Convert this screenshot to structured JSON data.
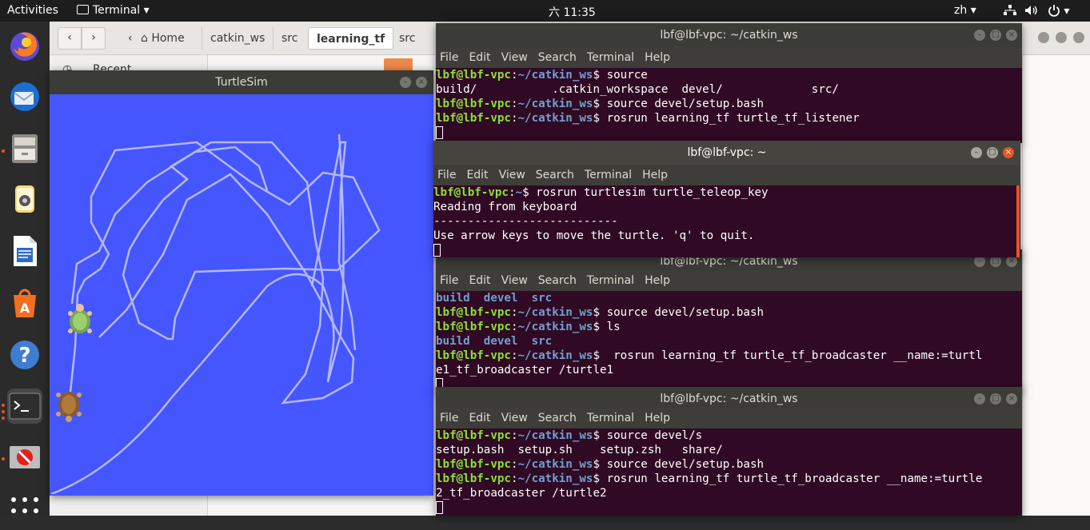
{
  "topbar": {
    "activities": "Activities",
    "app_menu": "Terminal",
    "app_menu_arrow": "▾",
    "clock": "六 11:35",
    "lang": "zh",
    "lang_arrow": "▾",
    "power_arrow": "▾"
  },
  "dock": {
    "items": [
      "Firefox",
      "Thunderbird",
      "Files",
      "Rhythmbox",
      "LibreOffice Writer",
      "Ubuntu Software",
      "Help",
      "Terminal",
      "Disabled App",
      "Show Applications"
    ]
  },
  "files": {
    "nav_back": "‹",
    "nav_forward": "›",
    "crumbs": [
      "Home",
      "catkin_ws",
      "src",
      "learning_tf",
      "src"
    ],
    "active_crumb_index": 3,
    "sidebar_recent": "Recent"
  },
  "turtlesim": {
    "title": "TurtleSim",
    "bg_color": "#4556ff",
    "line_color": "#b3b8ff"
  },
  "term_a": {
    "title": "lbf@lbf-vpc: ~/catkin_ws",
    "menu": [
      "File",
      "Edit",
      "View",
      "Search",
      "Terminal",
      "Help"
    ],
    "lines": [
      {
        "user": "lbf@lbf-vpc",
        "path": "~/catkin_ws",
        "cmd": " source"
      },
      {
        "text": "build/           .catkin_workspace  devel/             src/"
      },
      {
        "user": "lbf@lbf-vpc",
        "path": "~/catkin_ws",
        "cmd": " source devel/setup.bash"
      },
      {
        "user": "lbf@lbf-vpc",
        "path": "~/catkin_ws",
        "cmd": " rosrun learning_tf turtle_tf_listener"
      }
    ]
  },
  "term_b": {
    "title": "lbf@lbf-vpc: ~",
    "menu": [
      "File",
      "Edit",
      "View",
      "Search",
      "Terminal",
      "Help"
    ],
    "lines": [
      {
        "user": "lbf@lbf-vpc",
        "path": "~",
        "cmd": " rosrun turtlesim turtle_teleop_key"
      },
      {
        "text": "Reading from keyboard"
      },
      {
        "text": "---------------------------"
      },
      {
        "text": "Use arrow keys to move the turtle. 'q' to quit."
      }
    ]
  },
  "term_c": {
    "title": "lbf@lbf-vpc: ~/catkin_ws",
    "menu": [
      "File",
      "Edit",
      "View",
      "Search",
      "Terminal",
      "Help"
    ],
    "lines": [
      {
        "dirs": "build  devel  src"
      },
      {
        "user": "lbf@lbf-vpc",
        "path": "~/catkin_ws",
        "cmd": " source devel/setup.bash"
      },
      {
        "user": "lbf@lbf-vpc",
        "path": "~/catkin_ws",
        "cmd": " ls"
      },
      {
        "dirs": "build  devel  src"
      },
      {
        "user": "lbf@lbf-vpc",
        "path": "~/catkin_ws",
        "cmd": "  rosrun learning_tf turtle_tf_broadcaster __name:=turtl"
      },
      {
        "text": "e1_tf_broadcaster /turtle1"
      }
    ]
  },
  "term_d": {
    "title": "lbf@lbf-vpc: ~/catkin_ws",
    "menu": [
      "File",
      "Edit",
      "View",
      "Search",
      "Terminal",
      "Help"
    ],
    "lines": [
      {
        "user": "lbf@lbf-vpc",
        "path": "~/catkin_ws",
        "cmd": " source devel/s"
      },
      {
        "text": "setup.bash  setup.sh    setup.zsh   share/"
      },
      {
        "user": "lbf@lbf-vpc",
        "path": "~/catkin_ws",
        "cmd": " source devel/setup.bash"
      },
      {
        "user": "lbf@lbf-vpc",
        "path": "~/catkin_ws",
        "cmd": " rosrun learning_tf turtle_tf_broadcaster __name:=turtle"
      },
      {
        "text": "2_tf_broadcaster /turtle2"
      }
    ]
  },
  "prompt_sep": ":",
  "prompt_end": "$"
}
